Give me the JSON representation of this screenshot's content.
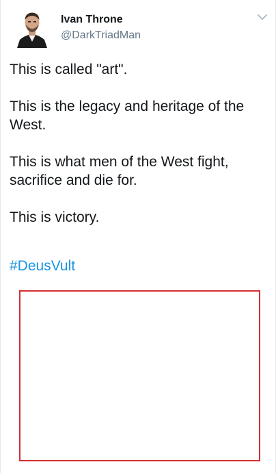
{
  "author": {
    "name": "Ivan Throne",
    "handle": "@DarkTriadMan",
    "avatar_icon": "profile-photo"
  },
  "menu": {
    "icon": "chevron-down-icon",
    "color": "#aab8c2"
  },
  "tweet": {
    "paragraphs": [
      "This is called \"art\".",
      "This is the legacy and heritage of the West.",
      "This is what men of the West fight, sacrifice and die for.",
      "This is victory."
    ],
    "hashtag": "#DeusVult"
  },
  "colors": {
    "text": "#14171a",
    "secondary_text": "#657786",
    "link": "#1b95e0",
    "media_border": "#d32f2f"
  }
}
